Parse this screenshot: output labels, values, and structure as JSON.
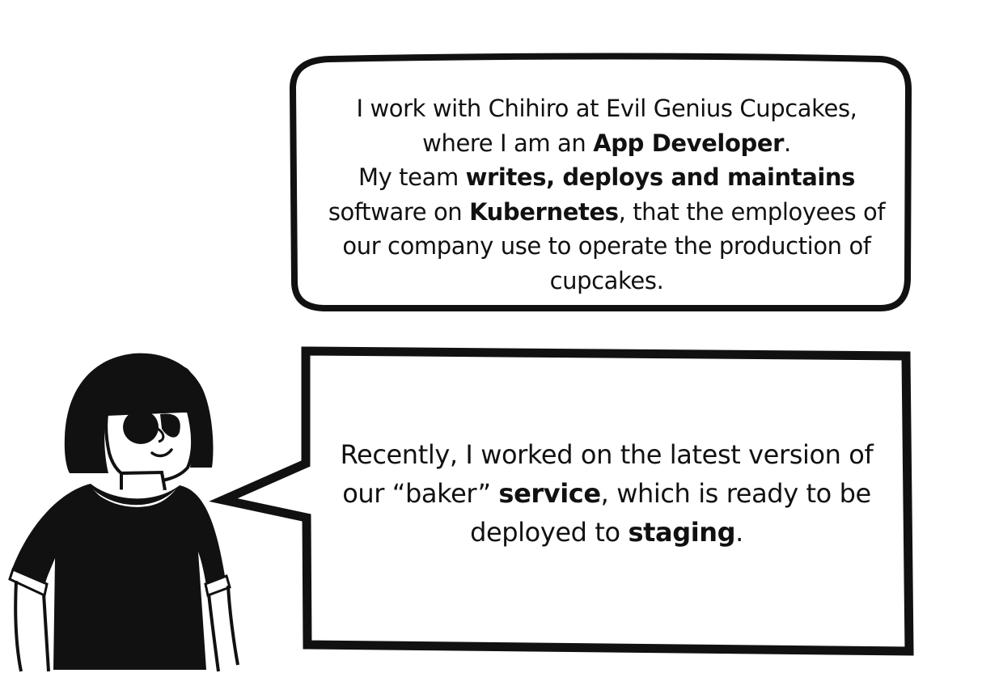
{
  "colors": {
    "ink": "#111111",
    "paper": "#ffffff"
  },
  "character": {
    "icon": "person-with-sunglasses-illustration"
  },
  "bubble_top": {
    "line1": "I work with Chihiro at Evil Genius Cupcakes,",
    "line2_pre": "where I am an ",
    "line2_bold": "App Developer",
    "line2_post": ".",
    "line3_pre": "My team ",
    "line3_bold": "writes, deploys and maintains",
    "line4_pre": "software on ",
    "line4_bold": "Kubernetes",
    "line4_post": ", that the employees of",
    "line5": "our company use to operate the production of",
    "line6": "cupcakes."
  },
  "bubble_bottom": {
    "line1": "Recently, I worked on the latest version of",
    "line2_pre": "our “baker” ",
    "line2_bold": "service",
    "line2_post": ", which is ready to be",
    "line3_pre": "deployed to ",
    "line3_bold": "staging",
    "line3_post": "."
  }
}
